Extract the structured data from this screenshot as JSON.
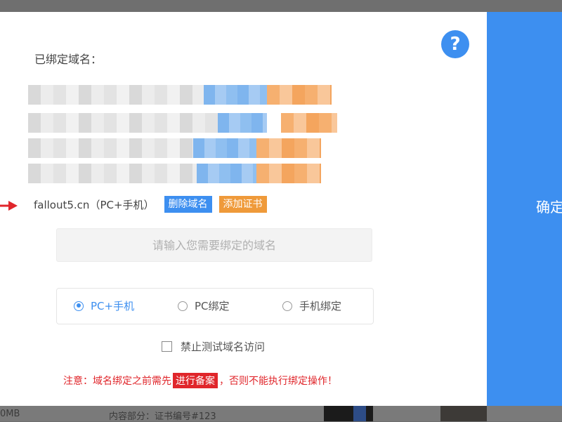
{
  "background": {
    "size_text": "0MB",
    "content_text": "内容部分：证书编号#123"
  },
  "modal": {
    "bound_domains_title": "已绑定域名：",
    "domain": {
      "name": "fallout5.cn（PC+手机）",
      "delete_label": "删除域名",
      "add_cert_label": "添加证书"
    },
    "input": {
      "placeholder": "请输入您需要绑定的域名",
      "value": ""
    },
    "radio_options": [
      {
        "label": "PC+手机",
        "selected": true
      },
      {
        "label": "PC绑定",
        "selected": false
      },
      {
        "label": "手机绑定",
        "selected": false
      }
    ],
    "checkbox_label": "禁止测试域名访问",
    "notice": {
      "prefix": "注意：域名绑定之前需先",
      "highlight": "进行备案",
      "suffix": "，否则不能执行绑定操作！"
    },
    "help_symbol": "?",
    "confirm_label": "确定"
  },
  "colors": {
    "accent": "#3d8ff0",
    "orange": "#ef9a3a",
    "warning": "#e0262b"
  }
}
